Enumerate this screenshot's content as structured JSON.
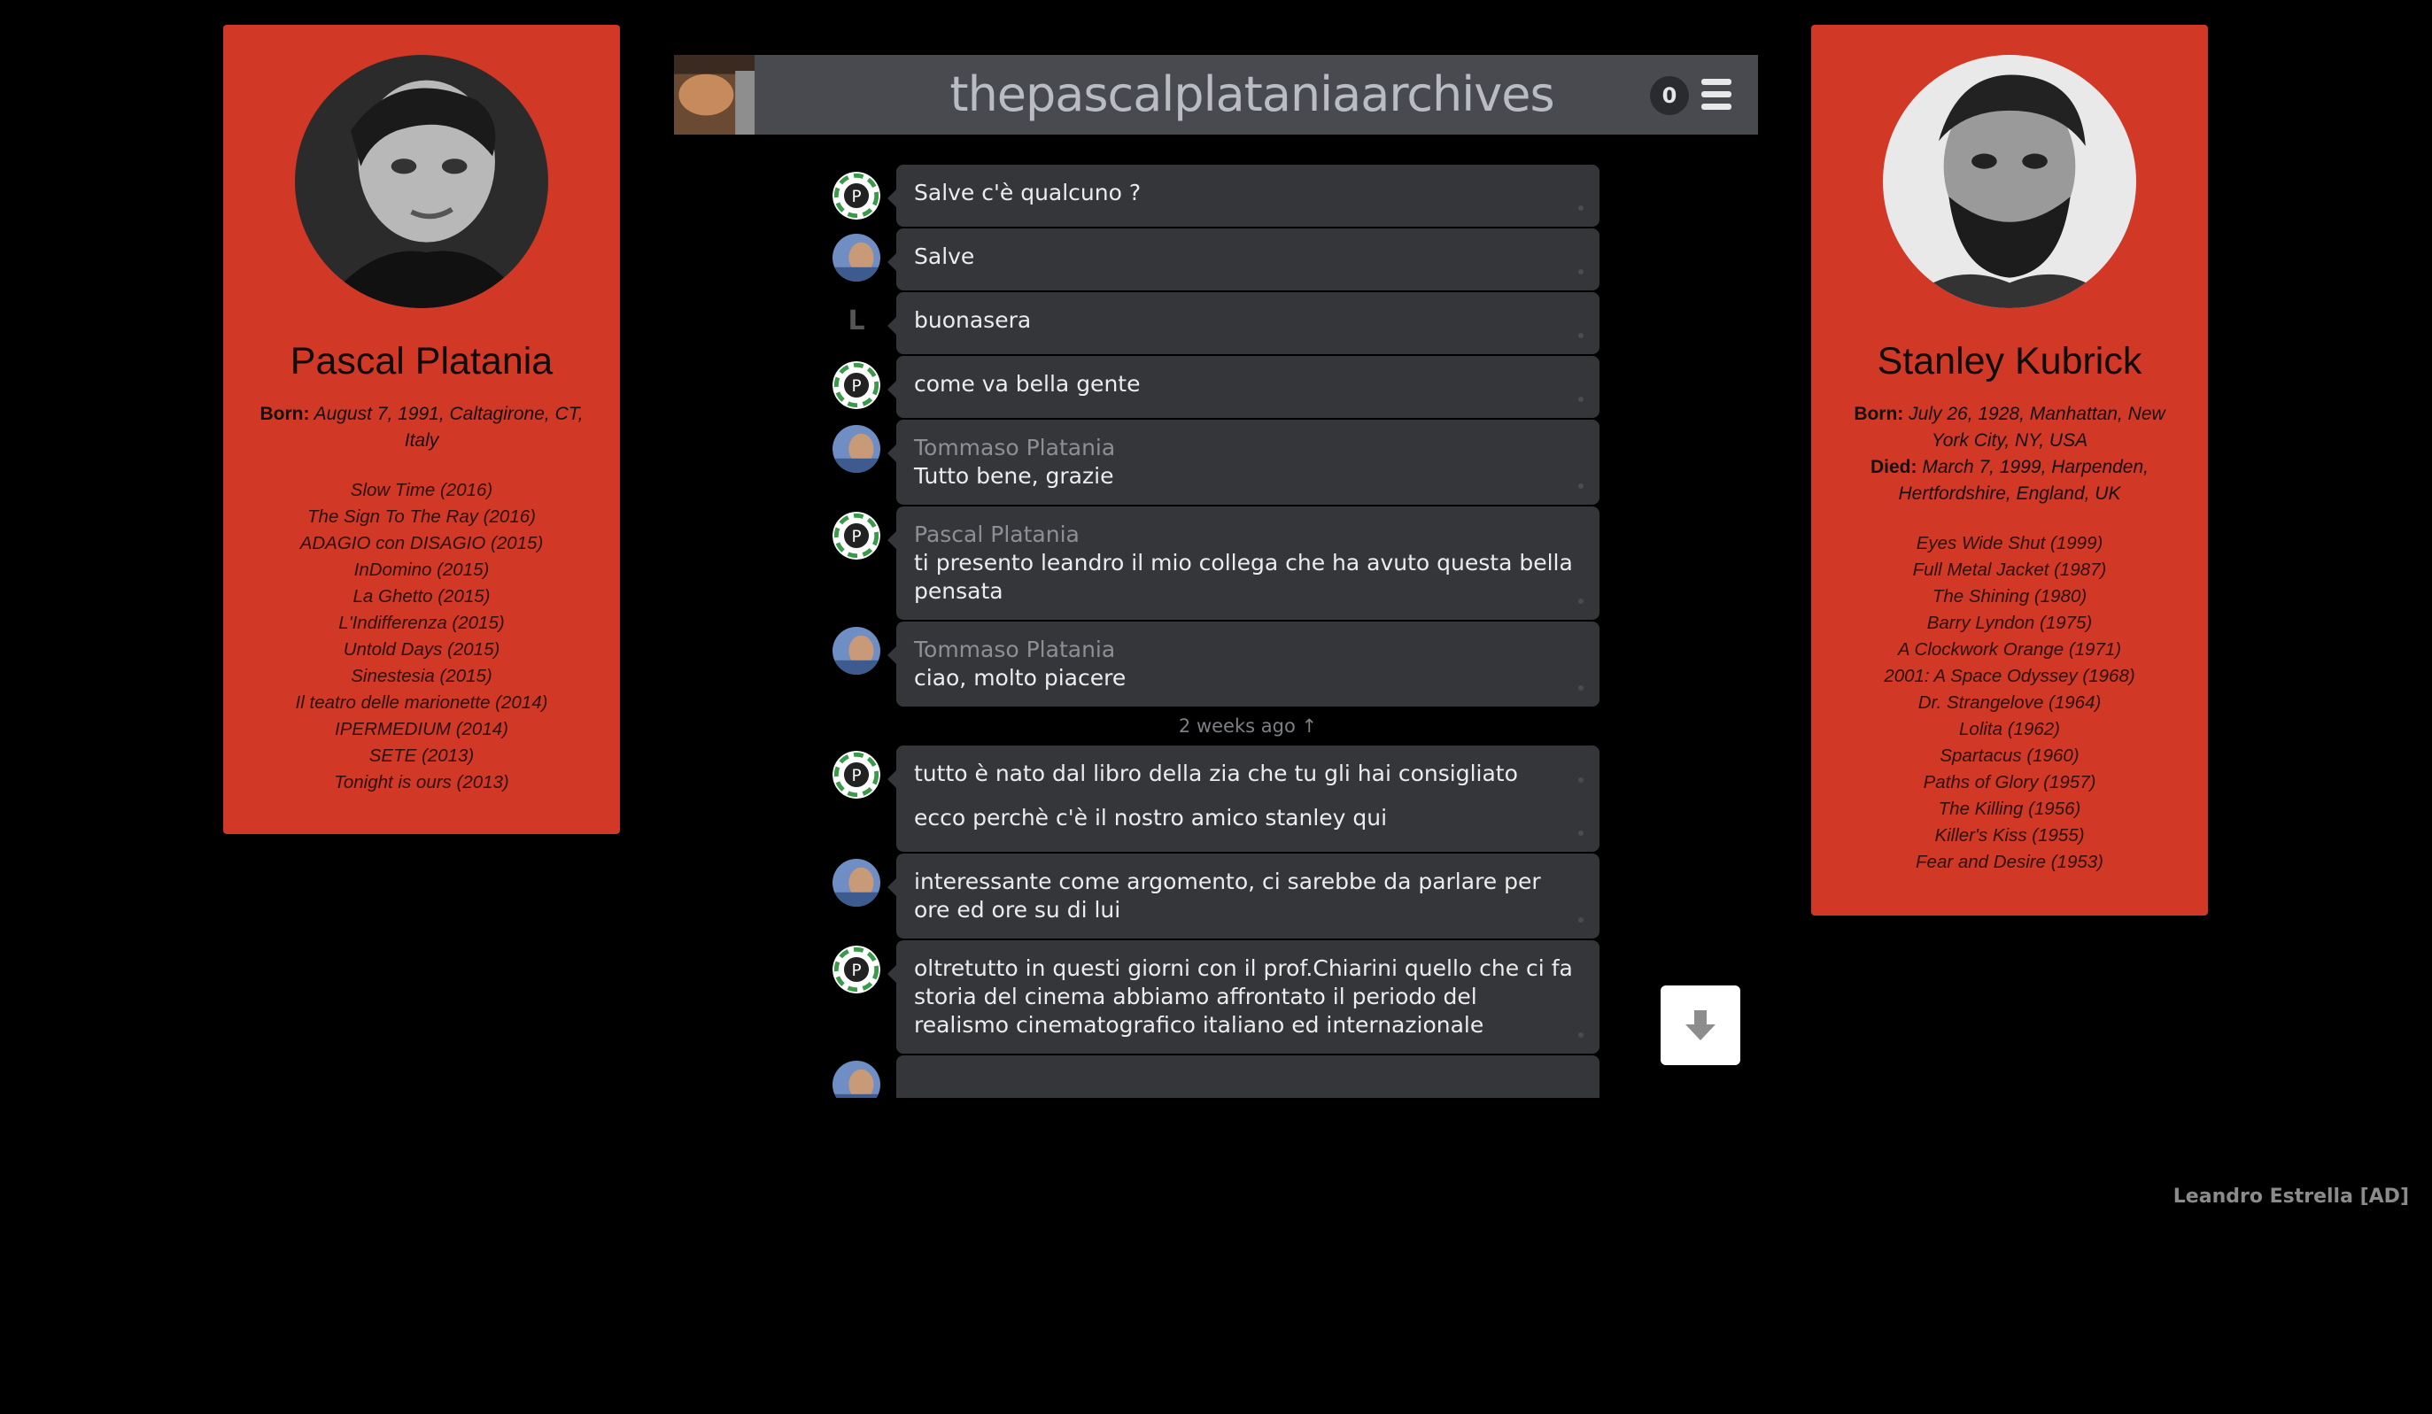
{
  "left_profile": {
    "name": "Pascal Platania",
    "born_label": "Born:",
    "born_value": "August 7, 1991, Caltagirone, CT, Italy",
    "works": [
      "Slow Time (2016)",
      "The Sign To The Ray (2016)",
      "ADAGIO con DISAGIO (2015)",
      "InDomino (2015)",
      "La Ghetto (2015)",
      "L'Indifferenza (2015)",
      "Untold Days (2015)",
      "Sinestesia (2015)",
      "Il teatro delle marionette (2014)",
      "IPERMEDIUM (2014)",
      "SETE (2013)",
      "Tonight is ours (2013)"
    ]
  },
  "right_profile": {
    "name": "Stanley Kubrick",
    "born_label": "Born:",
    "born_value": "July 26, 1928, Manhattan, New York City, NY, USA",
    "died_label": "Died:",
    "died_value": "March 7, 1999, Harpenden, Hertfordshire, England, UK",
    "works": [
      "Eyes Wide Shut (1999)",
      "Full Metal Jacket (1987)",
      "The Shining (1980)",
      "Barry Lyndon (1975)",
      "A Clockwork Orange (1971)",
      "2001: A Space Odyssey (1968)",
      "Dr. Strangelove (1964)",
      "Lolita (1962)",
      "Spartacus (1960)",
      "Paths of Glory (1957)",
      "The Killing (1956)",
      "Killer's Kiss (1955)",
      "Fear and Desire (1953)"
    ]
  },
  "header": {
    "title": "thepascalplataniaarchives",
    "unread_count": "0"
  },
  "chat": {
    "msg1": "Salve c'è qualcuno ?",
    "msg2": "Salve",
    "msg3_avatar_letter": "L",
    "msg3": "buonasera",
    "msg4": "come va bella gente",
    "msg5_name": "Tommaso Platania",
    "msg5": "Tutto bene, grazie",
    "msg6_name": "Pascal Platania",
    "msg6": "ti presento leandro il mio collega che ha avuto questa bella pensata",
    "msg7_name": "Tommaso Platania",
    "msg7": "ciao, molto piacere",
    "time_separator": "2 weeks ago ↑",
    "msg8a": "tutto è nato dal libro della zia che tu gli hai consigliato",
    "msg8b": "ecco perchè c'è il nostro amico stanley qui",
    "msg9": "interessante come argomento, ci sarebbe da parlare per ore ed ore su di lui",
    "msg10": "oltretutto in questi giorni con il prof.Chiarini quello che ci fa storia del cinema abbiamo affrontato il periodo del realismo cinematografico italiano ed internazionale"
  },
  "footer": {
    "credit": "Leandro Estrella [AD]"
  },
  "colors": {
    "card_red": "#d13826",
    "bubble": "#35363a",
    "topbar": "#484a4f",
    "background": "#000000"
  },
  "icons": {
    "menu": "hamburger-menu-icon",
    "scroll": "arrow-down-icon"
  }
}
